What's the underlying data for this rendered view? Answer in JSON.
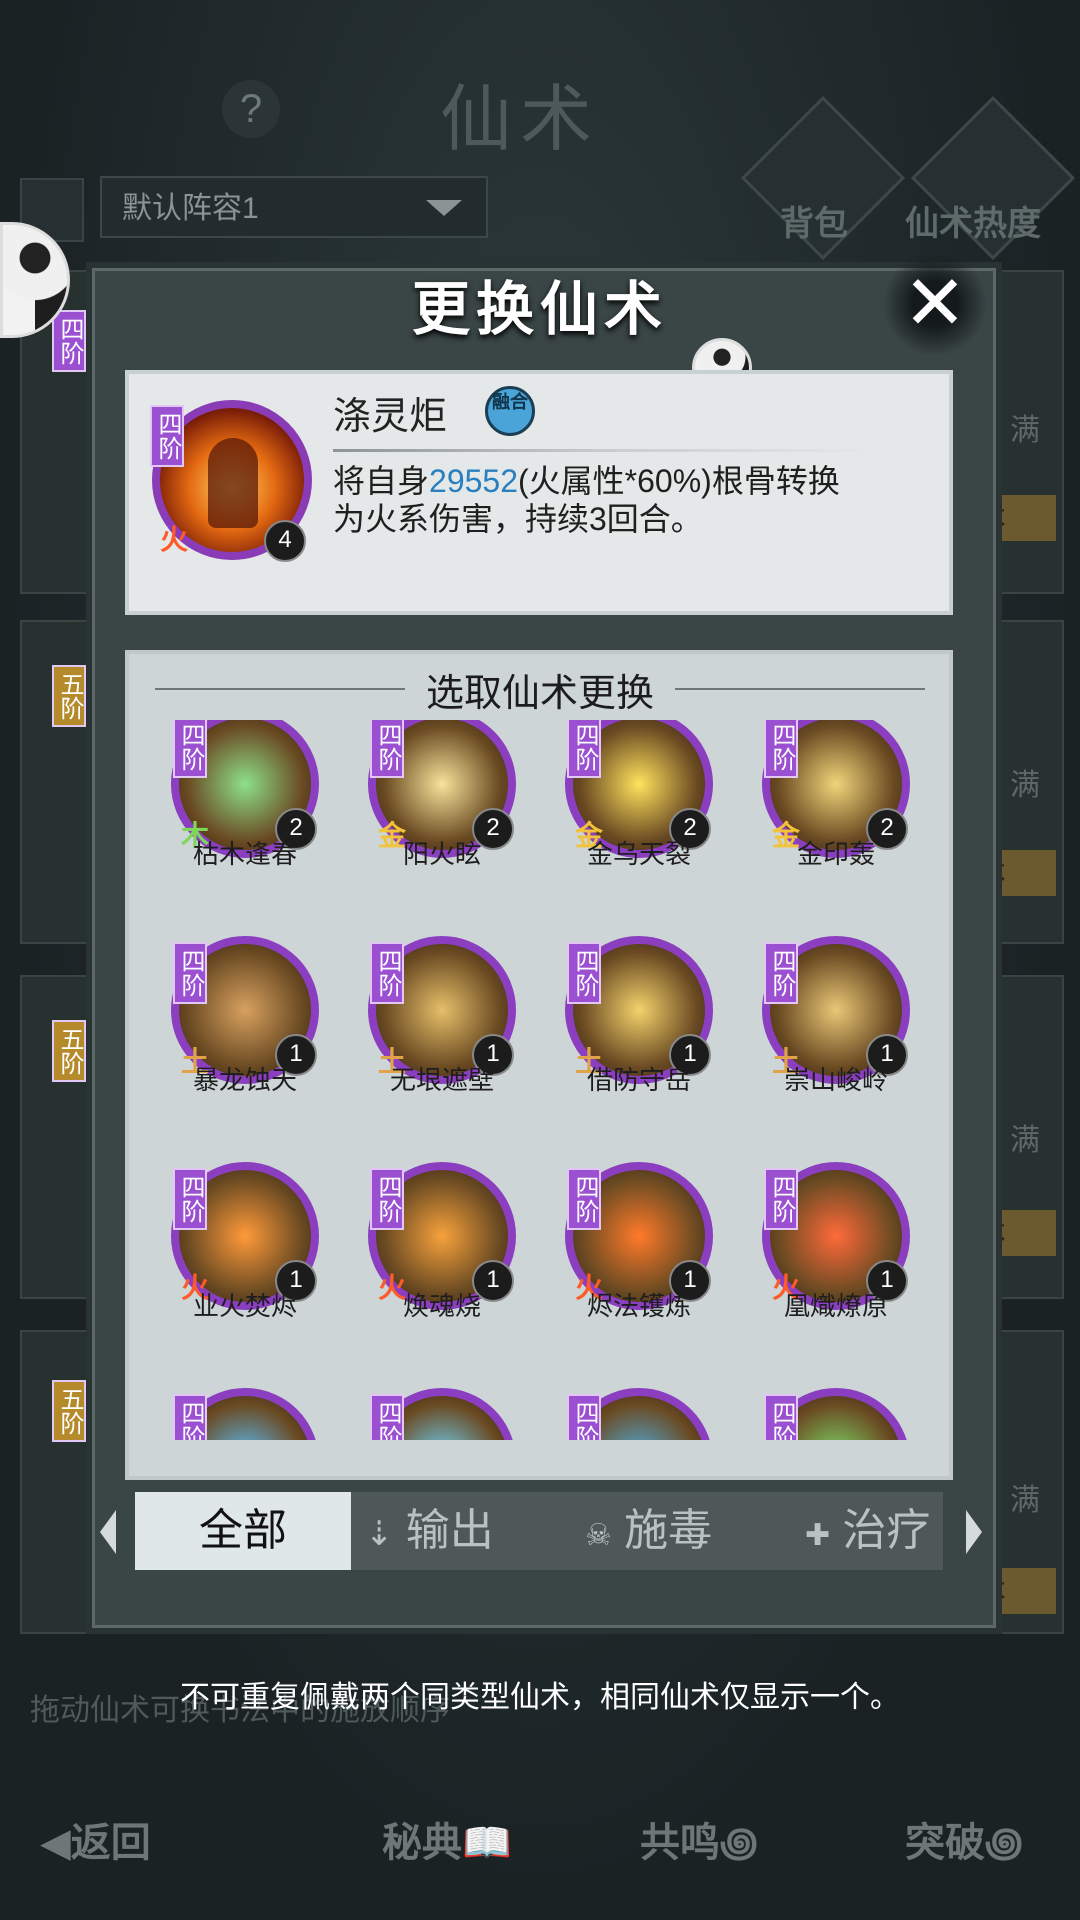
{
  "background": {
    "title": "仙术",
    "help_icon": "?",
    "lineup_label": "默认阵容1",
    "bag_label": "背包",
    "heat_label": "仙术热度",
    "side_man_label": "满",
    "side_btn_label": "术",
    "side_tiers": [
      "四阶",
      "五阶",
      "五阶",
      "五阶"
    ],
    "drag_hint": "拖动仙术可换书法中的施放顺序",
    "bottom_nav": {
      "back": "返回",
      "secret": "秘典",
      "resonance": "共鸣",
      "breakthrough": "突破"
    }
  },
  "modal": {
    "title": "更换仙术",
    "close_icon": "close-x-icon",
    "current_skill": {
      "tier": "四阶",
      "element": "火",
      "count": "4",
      "name": "涤灵炬",
      "fusion_badge": "融合",
      "description_prefix": "将自身",
      "description_number": "29552",
      "description_suffix": "(火属性*60%)根骨转换为火系伤害，持续3回合。"
    },
    "select_title": "选取仙术更换",
    "skills": [
      {
        "name": "枯木逢春",
        "tier": "四阶",
        "element": "木",
        "count": "2",
        "elem_color": "#7fd65a",
        "glow": "#8ee08a"
      },
      {
        "name": "阳火眩",
        "tier": "四阶",
        "element": "金",
        "count": "2",
        "elem_color": "#f2c23a",
        "glow": "#f6e39a"
      },
      {
        "name": "金乌天裂",
        "tier": "四阶",
        "element": "金",
        "count": "2",
        "elem_color": "#f2c23a",
        "glow": "#ffe25e"
      },
      {
        "name": "金印轰",
        "tier": "四阶",
        "element": "金",
        "count": "2",
        "elem_color": "#f2c23a",
        "glow": "#f0d57a"
      },
      {
        "name": "暴龙蚀天",
        "tier": "四阶",
        "element": "土",
        "count": "1",
        "elem_color": "#e0a34a",
        "glow": "#d7a160"
      },
      {
        "name": "无垠遮壁",
        "tier": "四阶",
        "element": "土",
        "count": "1",
        "elem_color": "#e0a34a",
        "glow": "#e6bf6a"
      },
      {
        "name": "借防守岳",
        "tier": "四阶",
        "element": "土",
        "count": "1",
        "elem_color": "#e0a34a",
        "glow": "#f3d26c"
      },
      {
        "name": "崇山峻岭",
        "tier": "四阶",
        "element": "土",
        "count": "1",
        "elem_color": "#e0a34a",
        "glow": "#e9c777"
      },
      {
        "name": "业火焚烬",
        "tier": "四阶",
        "element": "火",
        "count": "1",
        "elem_color": "#ff5a2a",
        "glow": "#ff9a3a"
      },
      {
        "name": "焕魂烧",
        "tier": "四阶",
        "element": "火",
        "count": "1",
        "elem_color": "#ff5a2a",
        "glow": "#f7a23c"
      },
      {
        "name": "烬法镬炼",
        "tier": "四阶",
        "element": "火",
        "count": "1",
        "elem_color": "#ff5a2a",
        "glow": "#ff7a2a"
      },
      {
        "name": "凰熾燎原",
        "tier": "四阶",
        "element": "火",
        "count": "1",
        "elem_color": "#ff5a2a",
        "glow": "#ff6a3a"
      },
      {
        "name": "",
        "tier": "四阶",
        "element": "",
        "count": "",
        "elem_color": "#5ad0ff",
        "glow": "#5bc2ff"
      },
      {
        "name": "",
        "tier": "四阶",
        "element": "",
        "count": "",
        "elem_color": "#5ad0ff",
        "glow": "#6fd8ff"
      },
      {
        "name": "",
        "tier": "四阶",
        "element": "",
        "count": "",
        "elem_color": "#5ad0ff",
        "glow": "#4fb2e6"
      },
      {
        "name": "",
        "tier": "四阶",
        "element": "",
        "count": "",
        "elem_color": "#7fd65a",
        "glow": "#7ee06a"
      }
    ],
    "tabs": [
      {
        "label": "全部",
        "icon": ""
      },
      {
        "label": "输出",
        "icon": "output-icon"
      },
      {
        "label": "施毒",
        "icon": "poison-icon"
      },
      {
        "label": "治疗",
        "icon": "heal-icon"
      }
    ],
    "footer_note": "不可重复佩戴两个同类型仙术，相同仙术仅显示一个。"
  }
}
